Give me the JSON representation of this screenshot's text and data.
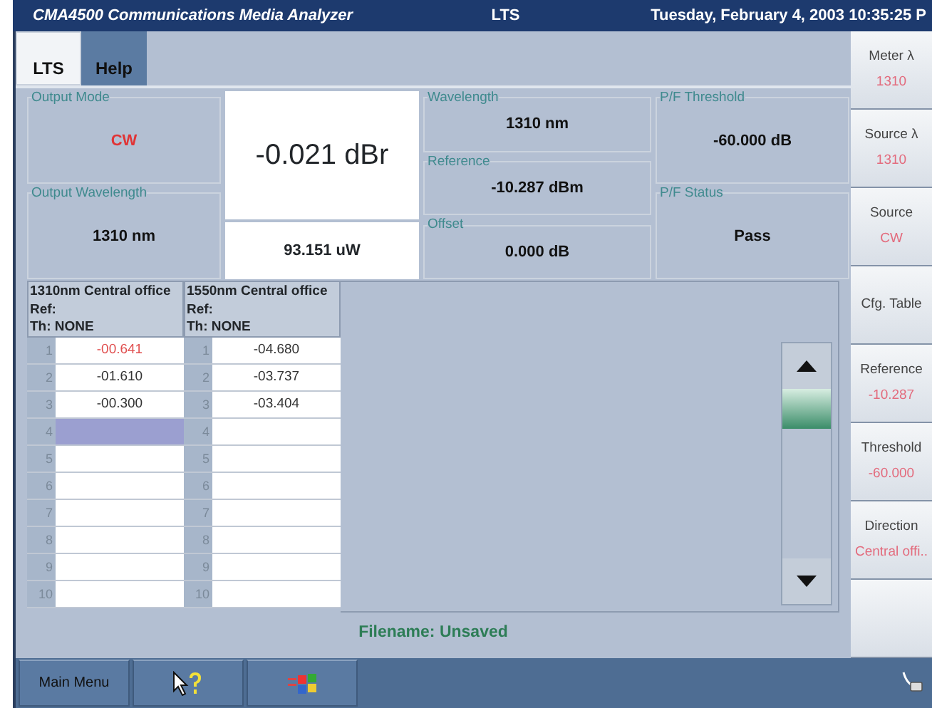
{
  "title_bar": {
    "app": "CMA4500 Communications Media Analyzer",
    "screen": "LTS",
    "datetime": "Tuesday, February 4, 2003 10:35:25 P"
  },
  "tabs": [
    {
      "label": "LTS",
      "selected": true
    },
    {
      "label": "Help",
      "selected": false
    }
  ],
  "output_mode": {
    "label": "Output Mode",
    "value": "CW"
  },
  "output_wavelength": {
    "label": "Output Wavelength",
    "value": "1310 nm"
  },
  "main_reading": "-0.021 dBr",
  "power_reading": "93.151 uW",
  "wavelength": {
    "label": "Wavelength",
    "value": "1310 nm"
  },
  "reference": {
    "label": "Reference",
    "value": "-10.287 dBm"
  },
  "offset": {
    "label": "Offset",
    "value": "0.000 dB"
  },
  "pf_threshold": {
    "label": "P/F Threshold",
    "value": "-60.000 dB"
  },
  "pf_status": {
    "label": "P/F Status",
    "value": "Pass"
  },
  "table": {
    "columns": [
      {
        "header": [
          "1310nm Central office",
          "Ref:",
          "Th: NONE"
        ],
        "rows": [
          {
            "index": "1",
            "value": "-00.641",
            "flagged": true,
            "selected": false
          },
          {
            "index": "2",
            "value": "-01.610",
            "flagged": false,
            "selected": false
          },
          {
            "index": "3",
            "value": "-00.300",
            "flagged": false,
            "selected": false
          },
          {
            "index": "4",
            "selected": true
          },
          {
            "index": "5",
            "selected": false
          },
          {
            "index": "6",
            "selected": false
          },
          {
            "index": "7",
            "selected": false
          },
          {
            "index": "8",
            "selected": false
          },
          {
            "index": "9",
            "selected": false
          },
          {
            "index": "10",
            "selected": false
          }
        ]
      },
      {
        "header": [
          "1550nm Central office",
          "Ref:",
          "Th: NONE"
        ],
        "rows": [
          {
            "index": "1",
            "value": "-04.680",
            "flagged": false,
            "selected": false
          },
          {
            "index": "2",
            "value": "-03.737",
            "flagged": false,
            "selected": false
          },
          {
            "index": "3",
            "value": "-03.404",
            "flagged": false,
            "selected": false
          },
          {
            "index": "4",
            "selected": false
          },
          {
            "index": "5",
            "selected": false
          },
          {
            "index": "6",
            "selected": false
          },
          {
            "index": "7",
            "selected": false
          },
          {
            "index": "8",
            "selected": false
          },
          {
            "index": "9",
            "selected": false
          },
          {
            "index": "10",
            "selected": false
          }
        ]
      }
    ]
  },
  "filename": "Filename: Unsaved",
  "softkeys": [
    {
      "label": "Meter λ",
      "value": "1310"
    },
    {
      "label": "Source λ",
      "value": "1310"
    },
    {
      "label": "Source",
      "value": "CW"
    },
    {
      "label": "Cfg. Table"
    },
    {
      "label": "Reference",
      "value": "-10.287"
    },
    {
      "label": "Threshold",
      "value": "-60.000"
    },
    {
      "label": "Direction",
      "value": "Central offi.."
    }
  ],
  "taskbar": {
    "main_menu": "Main Menu"
  }
}
